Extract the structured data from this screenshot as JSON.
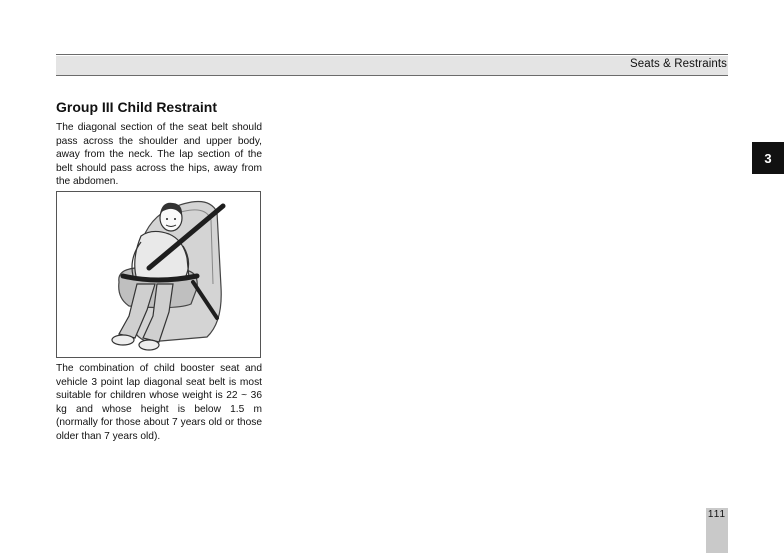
{
  "header": {
    "section": "Seats & Restraints",
    "chapter": "3"
  },
  "content": {
    "title": "Group III Child Restraint",
    "para1": "The diagonal section of the seat belt should pass across the shoulder and upper body, away from the neck. The lap section of the belt should pass across the hips, away from the abdomen.",
    "para2": "The combination of child booster seat and vehicle 3 point lap diagonal seat belt is most suitable for children whose weight is 22 ~ 36 kg and whose height is below 1.5 m (normally for those about 7 years old or those older than 7 years old)."
  },
  "figure": {
    "icon": "child-in-booster-seat-illustration"
  },
  "footer": {
    "page_number": "111"
  },
  "colors": {
    "header_band": "#e4e4e4",
    "rules": "#6b6b6b",
    "chapter_tab": "#111111",
    "page_tab": "#c9c9c9"
  }
}
